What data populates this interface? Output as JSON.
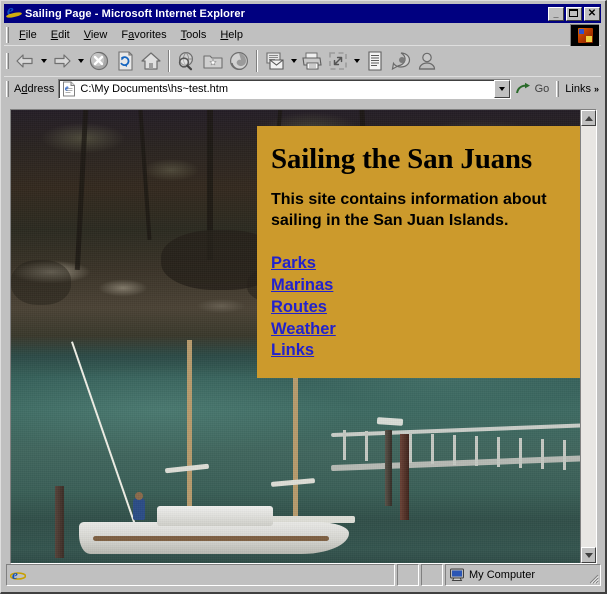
{
  "window": {
    "title": "Sailing Page - Microsoft Internet Explorer",
    "app_icon": "internet-explorer-icon",
    "minimize_glyph": "_",
    "maximize_glyph": "□",
    "close_glyph": "✕"
  },
  "menu": {
    "items": [
      {
        "label": "File",
        "accel": "F",
        "rest": "ile"
      },
      {
        "label": "Edit",
        "accel": "E",
        "rest": "dit"
      },
      {
        "label": "View",
        "accel": "V",
        "rest": "iew"
      },
      {
        "label": "Favorites",
        "pre": "F",
        "accel": "a",
        "rest": "vorites"
      },
      {
        "label": "Tools",
        "accel": "T",
        "rest": "ools"
      },
      {
        "label": "Help",
        "accel": "H",
        "rest": "elp"
      }
    ],
    "brand_icon": "ie-animated-logo-icon"
  },
  "toolbar": {
    "buttons": [
      {
        "name": "back-button",
        "icon": "arrow-left-icon",
        "label": "Back",
        "has_dropdown": true
      },
      {
        "name": "forward-button",
        "icon": "arrow-right-icon",
        "label": "Forward",
        "has_dropdown": true
      },
      {
        "name": "stop-button",
        "icon": "stop-x-circle-icon",
        "label": "Stop",
        "has_dropdown": false
      },
      {
        "name": "refresh-button",
        "icon": "refresh-page-icon",
        "label": "Refresh",
        "has_dropdown": false
      },
      {
        "name": "home-button",
        "icon": "home-house-icon",
        "label": "Home",
        "has_dropdown": false
      },
      {
        "name": "search-button",
        "icon": "search-globe-magnifier-icon",
        "label": "Search",
        "has_dropdown": false
      },
      {
        "name": "favorites-button",
        "icon": "favorites-folder-star-icon",
        "label": "Favorites",
        "has_dropdown": false
      },
      {
        "name": "history-button",
        "icon": "history-clock-swirl-icon",
        "label": "History",
        "has_dropdown": false
      },
      {
        "name": "mail-button",
        "icon": "mail-envelope-icon",
        "label": "Mail",
        "has_dropdown": true
      },
      {
        "name": "print-button",
        "icon": "printer-icon",
        "label": "Print",
        "has_dropdown": false
      },
      {
        "name": "edit-button",
        "icon": "fullscreen-resize-icon",
        "label": "Edit",
        "has_dropdown": true
      },
      {
        "name": "discuss-button",
        "icon": "document-lines-icon",
        "label": "Discuss",
        "has_dropdown": false
      },
      {
        "name": "messenger-button",
        "icon": "speech-bubble-icon",
        "label": "Messenger",
        "has_dropdown": false
      },
      {
        "name": "profile-button",
        "icon": "person-bust-icon",
        "label": "Profile",
        "has_dropdown": false
      }
    ]
  },
  "address_bar": {
    "label": "Address",
    "label_accel": "d",
    "value": "C:\\My Documents\\hs~test.htm",
    "placeholder": "",
    "doc_icon": "html-document-icon",
    "dropdown_icon": "chevron-down-icon",
    "go_label": "Go",
    "go_icon": "go-arrow-icon",
    "links_label": "Links",
    "links_chevron": "»"
  },
  "page": {
    "heading": "Sailing the San Juans",
    "paragraph": "This site contains information about sailing in the San Juan Islands.",
    "links": [
      {
        "label": "Parks"
      },
      {
        "label": "Marinas"
      },
      {
        "label": "Routes"
      },
      {
        "label": "Weather"
      },
      {
        "label": "Links"
      }
    ],
    "box_color": "#cc9a2c",
    "link_color": "#2222cc",
    "text_color": "#000000",
    "background_photo": "sailboat-anchored-near-rocky-shoreline-photo"
  },
  "scrollbar": {
    "up_icon": "scroll-up-arrow-icon",
    "down_icon": "scroll-down-arrow-icon"
  },
  "status_bar": {
    "message": "",
    "status_icon": "internet-explorer-icon",
    "zone_label": "My Computer",
    "zone_icon": "computer-monitor-icon"
  }
}
